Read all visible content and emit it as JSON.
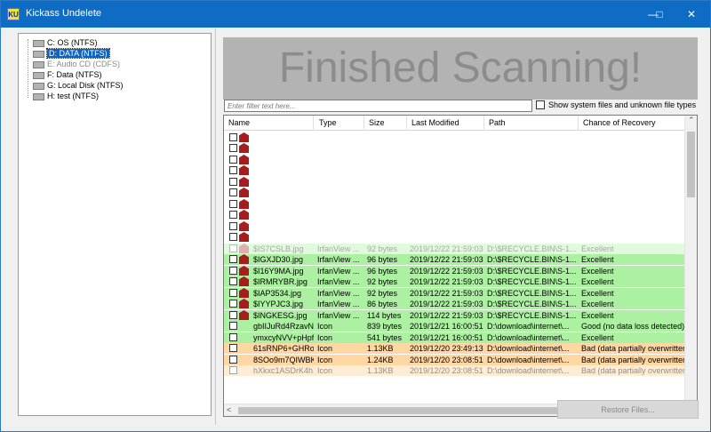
{
  "window": {
    "app_icon_text": "KU",
    "title": "Kickass Undelete",
    "controls": {
      "minimize": "—",
      "maximize": "□",
      "close": "✕"
    },
    "border_color": "#2b79c2"
  },
  "tree": {
    "items": [
      {
        "label": "C: OS (NTFS)"
      },
      {
        "label": "D: DATA (NTFS)"
      },
      {
        "label": "E: Audio CD (CDFS)"
      },
      {
        "label": "F: Data (NTFS)"
      },
      {
        "label": "G: Local Disk (NTFS)"
      },
      {
        "label": "H: test (NTFS)"
      }
    ],
    "selected_index": 1
  },
  "banner": {
    "text": "Finished Scanning!"
  },
  "filter": {
    "placeholder": "Enter filter text here..."
  },
  "show_system": {
    "label": "Show system files and unknown file types"
  },
  "table": {
    "columns": [
      "Name",
      "Type",
      "Size",
      "Last Modified",
      "Path",
      "Chance of Recovery"
    ],
    "partial_row": {
      "name": "$IS7CSLB.jpg",
      "type": "IrfanView ...",
      "size": "92 bytes",
      "modified": "2019/12/22 21:59:03",
      "path": "D:\\$RECYCLE.BIN\\S-1...",
      "recovery": "Excellent"
    },
    "rows": [
      {
        "name": "$IGXJD30.jpg",
        "type": "IrfanView ...",
        "size": "96 bytes",
        "modified": "2019/12/22 21:59:03",
        "path": "D:\\$RECYCLE.BIN\\S-1...",
        "recovery": "Excellent"
      },
      {
        "name": "$I16Y9MA.jpg",
        "type": "IrfanView ...",
        "size": "96 bytes",
        "modified": "2019/12/22 21:59:03",
        "path": "D:\\$RECYCLE.BIN\\S-1...",
        "recovery": "Excellent"
      },
      {
        "name": "$IRMRYBR.jpg",
        "type": "IrfanView ...",
        "size": "92 bytes",
        "modified": "2019/12/22 21:59:03",
        "path": "D:\\$RECYCLE.BIN\\S-1...",
        "recovery": "Excellent"
      },
      {
        "name": "$IAP3534.jpg",
        "type": "IrfanView ...",
        "size": "92 bytes",
        "modified": "2019/12/22 21:59:03",
        "path": "D:\\$RECYCLE.BIN\\S-1...",
        "recovery": "Excellent"
      },
      {
        "name": "$IYYPJC3.jpg",
        "type": "IrfanView ...",
        "size": "86 bytes",
        "modified": "2019/12/22 21:59:03",
        "path": "D:\\$RECYCLE.BIN\\S-1...",
        "recovery": "Excellent"
      },
      {
        "name": "$INGKESG.jpg",
        "type": "IrfanView ...",
        "size": "114 bytes",
        "modified": "2019/12/22 21:59:03",
        "path": "D:\\$RECYCLE.BIN\\S-1...",
        "recovery": "Excellent"
      },
      {
        "name": "gbIIJuRd4RzavN...",
        "type": "Icon",
        "size": "839 bytes",
        "modified": "2019/12/21 16:00:51",
        "path": "D:\\download\\internet\\...",
        "recovery": "Good (no data loss detected)"
      },
      {
        "name": "ymxcyNVV+pHpf...",
        "type": "Icon",
        "size": "541 bytes",
        "modified": "2019/12/21 16:00:51",
        "path": "D:\\download\\internet\\...",
        "recovery": "Excellent"
      },
      {
        "name": "61sRNP6+GHRor...",
        "type": "Icon",
        "size": "1.13KB",
        "modified": "2019/12/20 23:49:13",
        "path": "D:\\download\\internet\\...",
        "recovery": "Bad (data partially overwritten)"
      },
      {
        "name": "8SOo9m7QIWBKz...",
        "type": "Icon",
        "size": "1.24KB",
        "modified": "2019/12/20 23:08:51",
        "path": "D:\\download\\internet\\...",
        "recovery": "Bad (data partially overwritten)"
      },
      {
        "name": "hXkxc1ASDrK4h...",
        "type": "Icon",
        "size": "1.13KB",
        "modified": "2019/12/20 23:08:51",
        "path": "D:\\download\\internet\\...",
        "recovery": "Bad (data partially overwritten)"
      }
    ]
  },
  "scroll": {
    "up": "⌃",
    "down": "⌄",
    "left": "<",
    "right": ">"
  },
  "restore": {
    "label": "Restore Files..."
  }
}
